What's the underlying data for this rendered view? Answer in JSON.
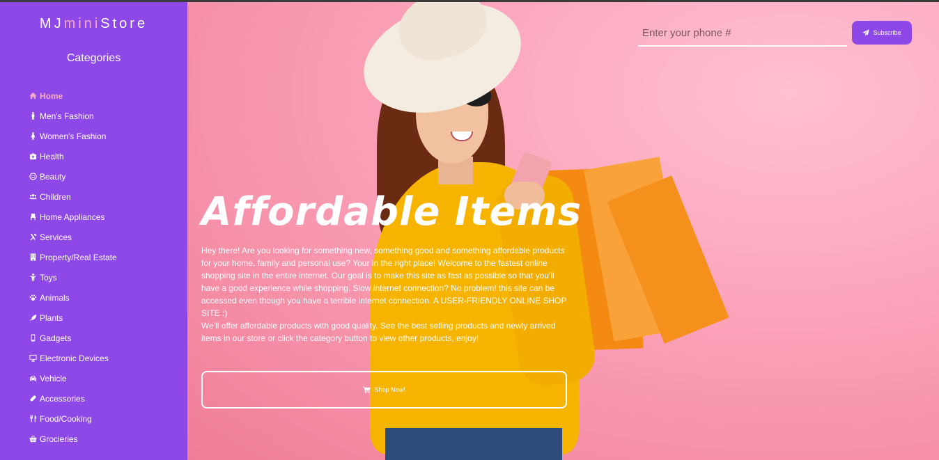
{
  "brand": {
    "part1": "MJ",
    "part2": "mini",
    "part3": "Store"
  },
  "sidebar": {
    "title": "Categories",
    "items": [
      {
        "label": "Home",
        "icon": "home-icon"
      },
      {
        "label": "Men's Fashion",
        "icon": "male-icon"
      },
      {
        "label": "Women's Fashion",
        "icon": "female-icon"
      },
      {
        "label": "Health",
        "icon": "medkit-icon"
      },
      {
        "label": "Beauty",
        "icon": "smile-icon"
      },
      {
        "label": "Children",
        "icon": "users-icon"
      },
      {
        "label": "Home Appliances",
        "icon": "chair-icon"
      },
      {
        "label": "Services",
        "icon": "tools-icon"
      },
      {
        "label": "Property/Real Estate",
        "icon": "building-icon"
      },
      {
        "label": "Toys",
        "icon": "child-icon"
      },
      {
        "label": "Animals",
        "icon": "paw-icon"
      },
      {
        "label": "Plants",
        "icon": "leaf-icon"
      },
      {
        "label": "Gadgets",
        "icon": "mobile-icon"
      },
      {
        "label": "Electronic Devices",
        "icon": "desktop-icon"
      },
      {
        "label": "Vehicle",
        "icon": "car-icon"
      },
      {
        "label": "Accessories",
        "icon": "pills-icon"
      },
      {
        "label": "Food/Cooking",
        "icon": "utensils-icon"
      },
      {
        "label": "Grocieries",
        "icon": "basket-icon"
      }
    ]
  },
  "hero": {
    "title": "Affordable Items",
    "paragraph1": "Hey there! Are you looking for something new, something good and something affordable products for your home, family and personal use? Your in the right place! Welcome to the fastest online shopping site in the entire internet. Our goal is to make this site as fast as possible so that you'll have a good experience while shopping. Slow internet connection? No problem! this site can be accessed even though you have a terrible internet connection. A USER-FRIENDLY ONLINE SHOP SITE :)",
    "paragraph2": "We'll offer affordable products with good quality. See the best selling products and newly arrived items in our store or click the category button to view other products, enjoy!",
    "shop_label": "Shop Now!"
  },
  "subscribe": {
    "placeholder": "Enter your phone #",
    "button_label": "Subscribe"
  },
  "colors": {
    "sidebar": "#8f48e8",
    "accent_pink": "#f7a9c9",
    "hero_bg": "#fda8bf"
  }
}
